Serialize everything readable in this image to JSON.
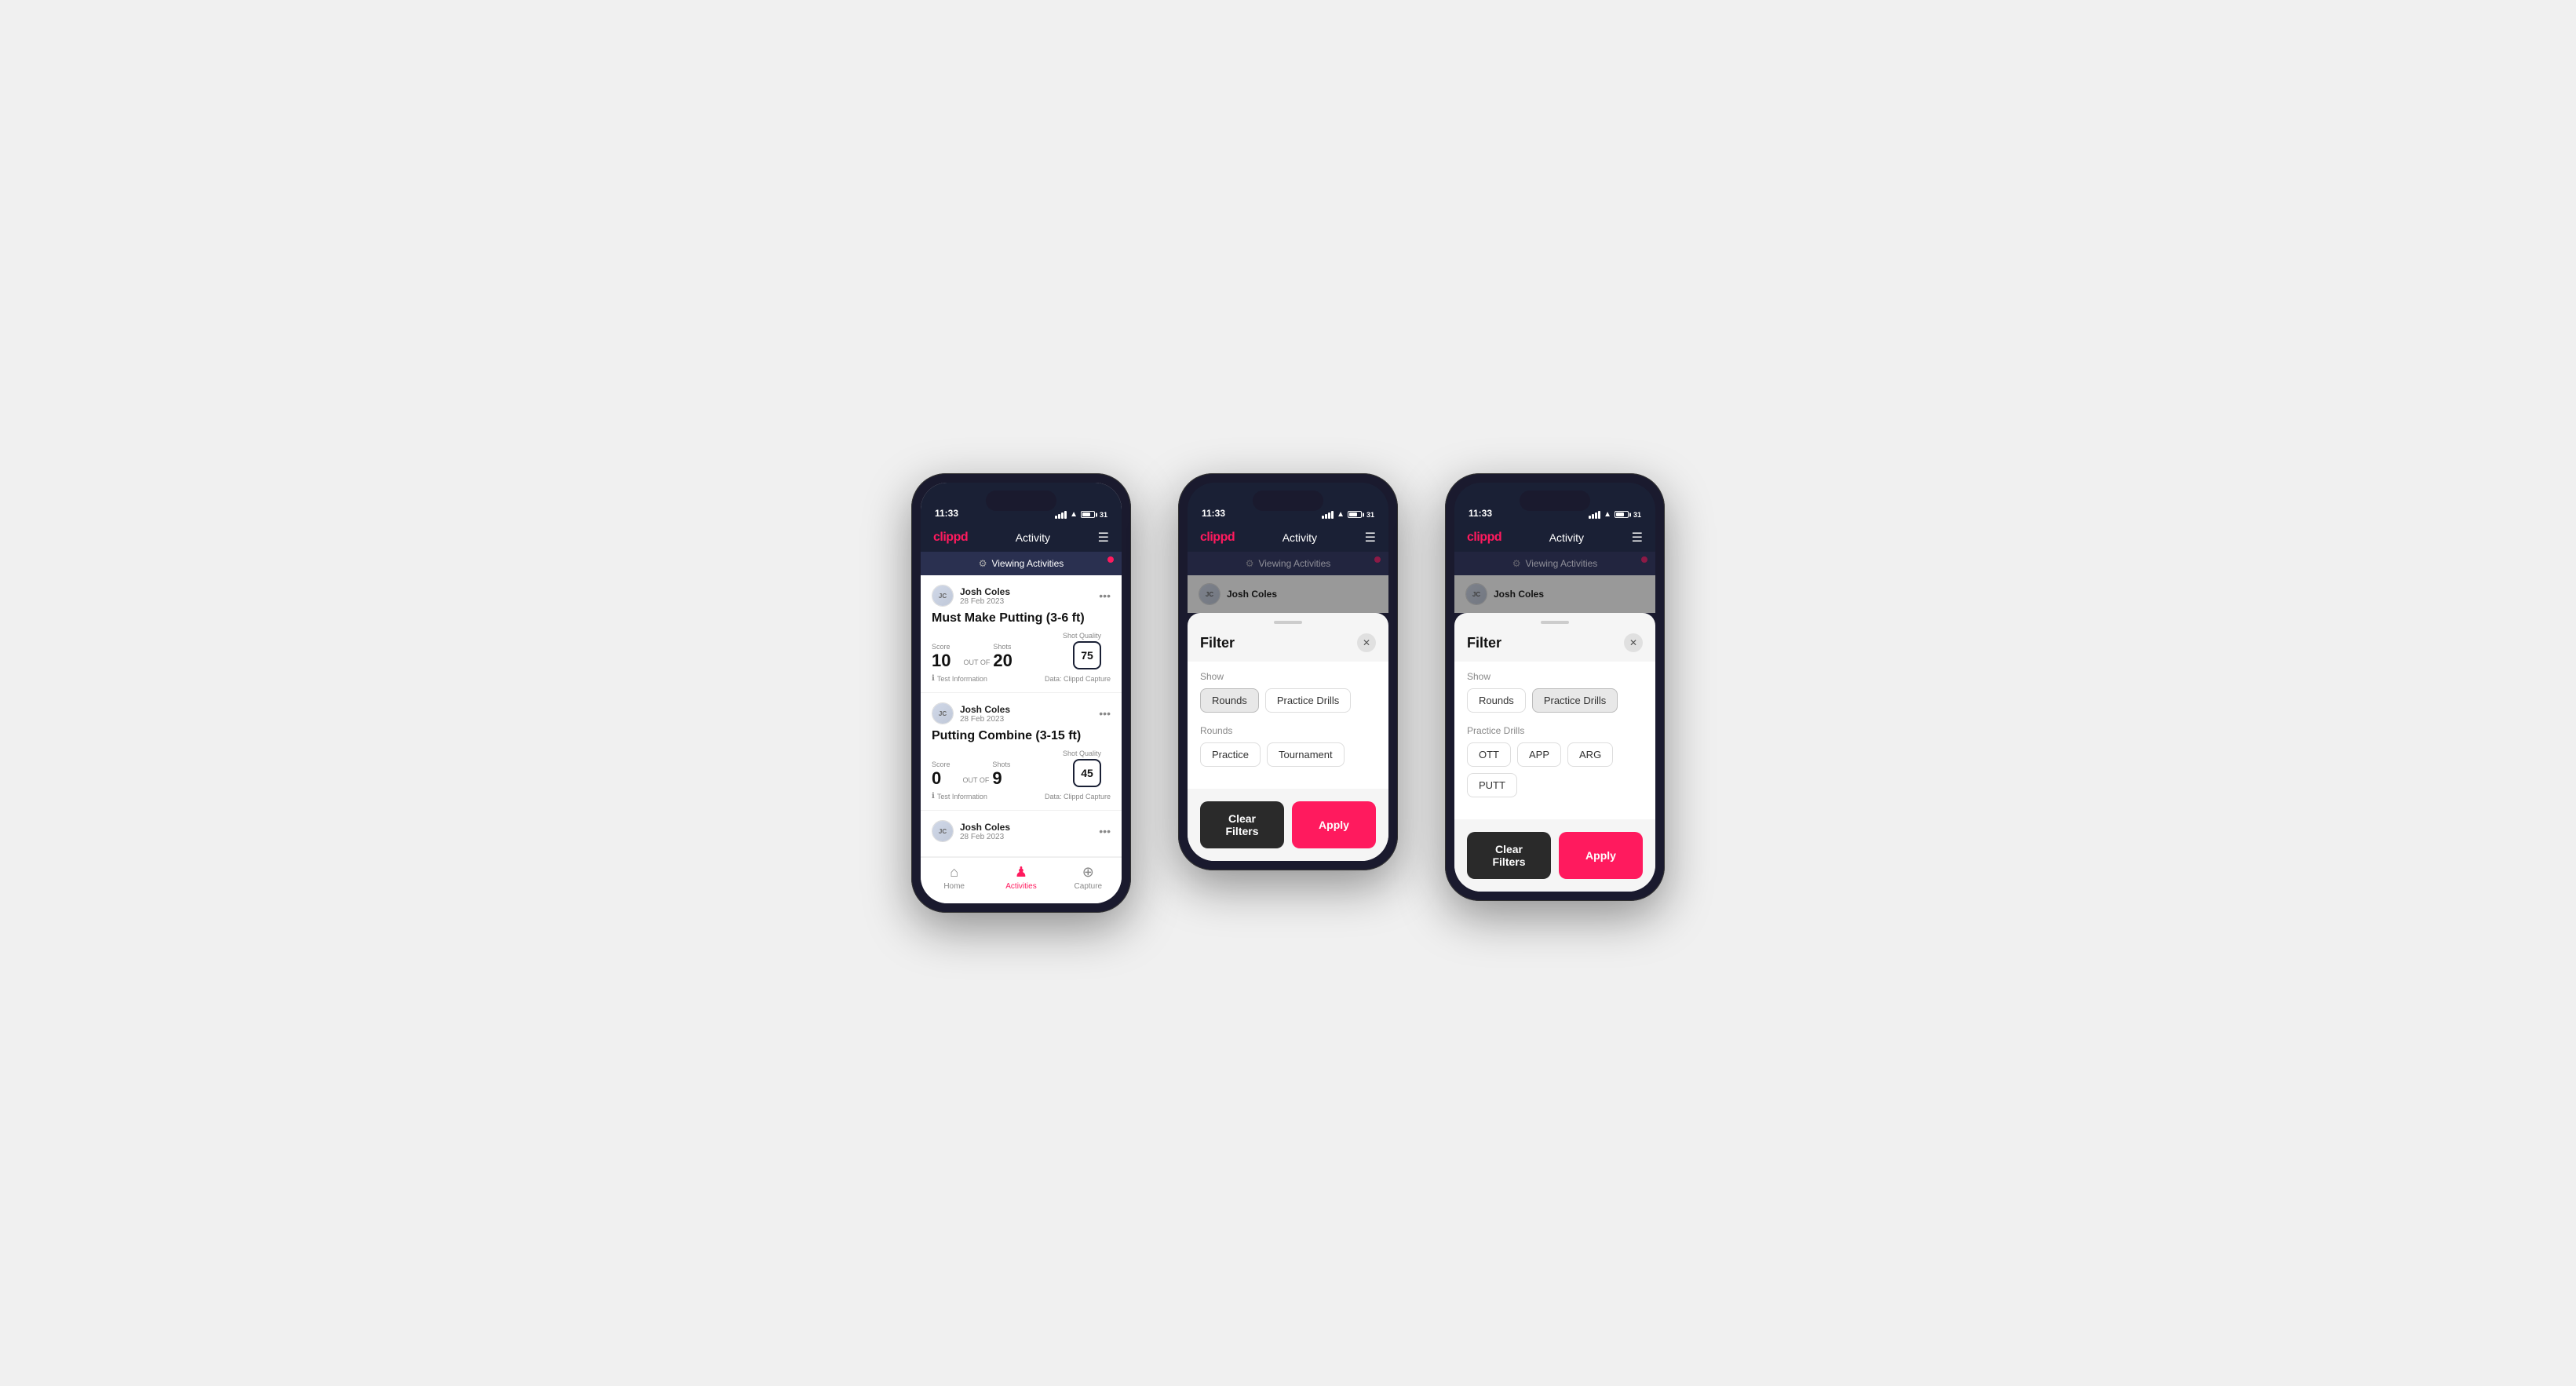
{
  "app": {
    "logo": "clippd",
    "title": "Activity",
    "time": "11:33",
    "battery": "31"
  },
  "phone1": {
    "viewing_bar": "Viewing Activities",
    "activities": [
      {
        "user_name": "Josh Coles",
        "user_date": "28 Feb 2023",
        "title": "Must Make Putting (3-6 ft)",
        "score_label": "Score",
        "score_value": "10",
        "out_of_label": "OUT OF",
        "shots_label": "Shots",
        "shots_value": "20",
        "sq_label": "Shot Quality",
        "sq_value": "75",
        "info_label": "Test Information",
        "data_label": "Data: Clippd Capture"
      },
      {
        "user_name": "Josh Coles",
        "user_date": "28 Feb 2023",
        "title": "Putting Combine (3-15 ft)",
        "score_label": "Score",
        "score_value": "0",
        "out_of_label": "OUT OF",
        "shots_label": "Shots",
        "shots_value": "9",
        "sq_label": "Shot Quality",
        "sq_value": "45",
        "info_label": "Test Information",
        "data_label": "Data: Clippd Capture"
      },
      {
        "user_name": "Josh Coles",
        "user_date": "28 Feb 2023",
        "title": "",
        "score_label": "",
        "score_value": "",
        "out_of_label": "",
        "shots_label": "",
        "shots_value": "",
        "sq_label": "",
        "sq_value": "",
        "info_label": "",
        "data_label": ""
      }
    ],
    "nav": {
      "home": "Home",
      "activities": "Activities",
      "capture": "Capture"
    }
  },
  "phone2": {
    "viewing_bar": "Viewing Activities",
    "filter_title": "Filter",
    "show_label": "Show",
    "rounds_label": "Rounds",
    "rounds_chip1": "Rounds",
    "rounds_chip2": "Practice Drills",
    "rounds_section_label": "Rounds",
    "round_chip1": "Practice",
    "round_chip2": "Tournament",
    "clear_filters": "Clear Filters",
    "apply": "Apply",
    "user_name": "Josh Coles"
  },
  "phone3": {
    "viewing_bar": "Viewing Activities",
    "filter_title": "Filter",
    "show_label": "Show",
    "rounds_chip1": "Rounds",
    "rounds_chip2": "Practice Drills",
    "drills_section_label": "Practice Drills",
    "drill_chip1": "OTT",
    "drill_chip2": "APP",
    "drill_chip3": "ARG",
    "drill_chip4": "PUTT",
    "clear_filters": "Clear Filters",
    "apply": "Apply",
    "user_name": "Josh Coles"
  }
}
